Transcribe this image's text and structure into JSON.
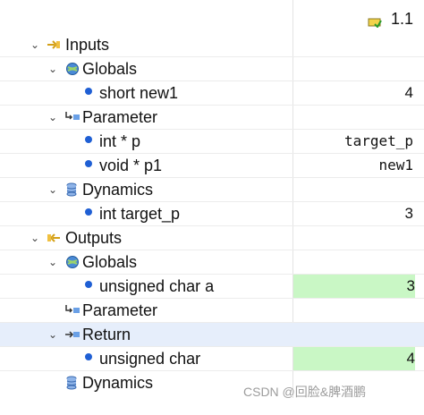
{
  "header": {
    "version": "1.1",
    "icon": "version-flag-icon"
  },
  "rows": [
    {
      "label": "Inputs",
      "value": "",
      "icon": "inputs-icon",
      "expanded": true
    },
    {
      "label": "Globals",
      "value": "",
      "icon": "globals-icon",
      "expanded": true
    },
    {
      "label": "short new1",
      "value": "4",
      "icon": "variable-dot-icon"
    },
    {
      "label": "Parameter",
      "value": "",
      "icon": "parameter-icon",
      "expanded": true
    },
    {
      "label": "int * p",
      "value": "target_p",
      "icon": "variable-dot-icon"
    },
    {
      "label": "void * p1",
      "value": "new1",
      "icon": "variable-dot-icon"
    },
    {
      "label": "Dynamics",
      "value": "",
      "icon": "dynamics-icon",
      "expanded": true
    },
    {
      "label": "int target_p",
      "value": "3",
      "icon": "variable-dot-icon"
    },
    {
      "label": "Outputs",
      "value": "",
      "icon": "outputs-icon",
      "expanded": true
    },
    {
      "label": "Globals",
      "value": "",
      "icon": "globals-icon",
      "expanded": true
    },
    {
      "label": "unsigned char a",
      "value": "3",
      "icon": "variable-dot-icon",
      "highlight": "#c9f7c5"
    },
    {
      "label": "Parameter",
      "value": "",
      "icon": "parameter-icon"
    },
    {
      "label": "Return",
      "value": "",
      "icon": "return-icon",
      "expanded": true,
      "selected": true
    },
    {
      "label": "unsigned char",
      "value": "4",
      "icon": "variable-dot-icon",
      "highlight": "#c9f7c5"
    },
    {
      "label": "Dynamics",
      "value": "",
      "icon": "dynamics-icon"
    }
  ],
  "watermark": "CSDN @回脸&脾酒鹏"
}
